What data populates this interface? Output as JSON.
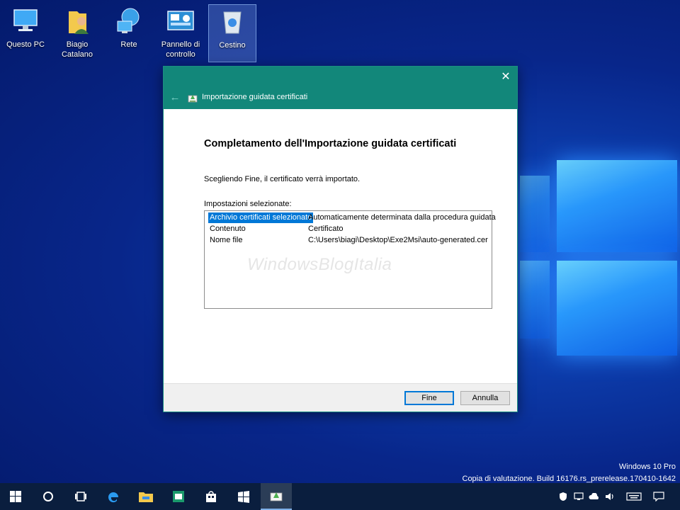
{
  "desktop": {
    "icons": [
      {
        "label": "Questo PC",
        "icon": "computer-icon"
      },
      {
        "label": "Biagio Catalano",
        "icon": "user-folder-icon"
      },
      {
        "label": "Rete",
        "icon": "network-icon"
      },
      {
        "label": "Pannello di controllo",
        "icon": "control-panel-icon"
      },
      {
        "label": "Cestino",
        "icon": "recycle-bin-icon"
      }
    ]
  },
  "dialog": {
    "title": "Importazione guidata certificati",
    "heading": "Completamento dell'Importazione guidata certificati",
    "description": "Scegliendo Fine, il certificato verrà importato.",
    "settings_label": "Impostazioni selezionate:",
    "settings": [
      {
        "key": "Archivio certificati selezionato",
        "value": "Automaticamente determinata dalla procedura guidata"
      },
      {
        "key": "Contenuto",
        "value": "Certificato"
      },
      {
        "key": "Nome file",
        "value": "C:\\Users\\biagi\\Desktop\\Exe2Msi\\auto-generated.cer"
      }
    ],
    "watermark": "WindowsBlogItalia",
    "finish_label": "Fine",
    "cancel_label": "Annulla"
  },
  "build": {
    "edition": "Windows 10 Pro",
    "info": "Copia di valutazione. Build 16176.rs_prerelease.170410-1642"
  },
  "taskbar": {
    "items": [
      "start-icon",
      "cortana-icon",
      "task-view-icon",
      "edge-icon",
      "file-explorer-icon",
      "store-app-icon",
      "store-icon",
      "windows-app-icon",
      "certificate-wizard-icon"
    ],
    "tray": [
      "defender-icon",
      "network-tray-icon",
      "onedrive-icon",
      "volume-icon",
      "keyboard-icon",
      "notification-icon"
    ]
  },
  "colors": {
    "accent": "#12877a",
    "selection": "#0078d7",
    "taskbar": "#0a1e3e"
  }
}
